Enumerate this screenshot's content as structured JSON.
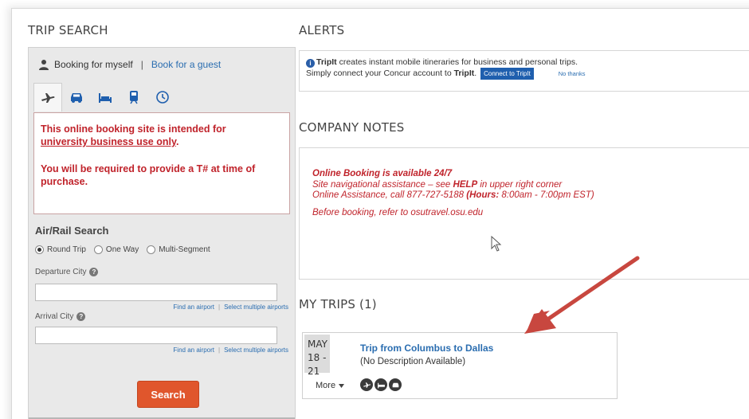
{
  "trip_search": {
    "title": "TRIP SEARCH",
    "booking_self": "Booking for myself",
    "separator": "|",
    "booking_guest": "Book for a guest",
    "tabs": [
      {
        "name": "flight-icon",
        "active": true
      },
      {
        "name": "car-icon"
      },
      {
        "name": "hotel-icon"
      },
      {
        "name": "train-icon"
      },
      {
        "name": "clock-icon"
      }
    ],
    "notice_line1_a": "This online booking site is intended for",
    "notice_line1_b": "university business use only",
    "notice_line1_c": ".",
    "notice_line2": "You will be required to provide a T# at time of purchase.",
    "airrail_title": "Air/Rail Search",
    "trip_types": [
      "Round Trip",
      "One Way",
      "Multi-Segment"
    ],
    "departure_label": "Departure City",
    "arrival_label": "Arrival City",
    "find_airport": "Find an airport",
    "link_sep": "|",
    "select_multiple": "Select multiple airports",
    "search_label": "Search"
  },
  "alerts": {
    "title": "ALERTS",
    "line1_brand": "TripIt",
    "line1_rest": " creates instant mobile itineraries for business and personal trips.",
    "line2_pre": "Simply connect your Concur account to ",
    "line2_brand": "TripIt",
    "line2_post": ".",
    "connect_label": "Connect to TripIt",
    "no_thanks": "No thanks"
  },
  "company_notes": {
    "title": "COMPANY NOTES",
    "line1": "Online Booking is available 24/7",
    "line2_pre": "Site navigational assistance  – see ",
    "line2_bold": "HELP",
    "line2_post": " in upper right corner",
    "line3_pre": "Online Assistance, call 877-727-5188  ",
    "line3_bold": "(Hours:",
    "line3_post": "  8:00am - 7:00pm EST)",
    "line4": "Before booking, refer to osutravel.osu.edu"
  },
  "my_trips": {
    "title": "MY TRIPS (1)",
    "trips": [
      {
        "month": "MAY",
        "days": "18 - 21",
        "name": "Trip from Columbus to Dallas",
        "description": "(No Description Available)",
        "more_label": "More",
        "modes": [
          "flight-icon",
          "hotel-icon",
          "car-icon"
        ]
      }
    ]
  },
  "colors": {
    "accent_red": "#c0232b",
    "link_blue": "#2a6db0",
    "search_orange": "#e0562c",
    "annotation_arrow": "#c8473f"
  }
}
